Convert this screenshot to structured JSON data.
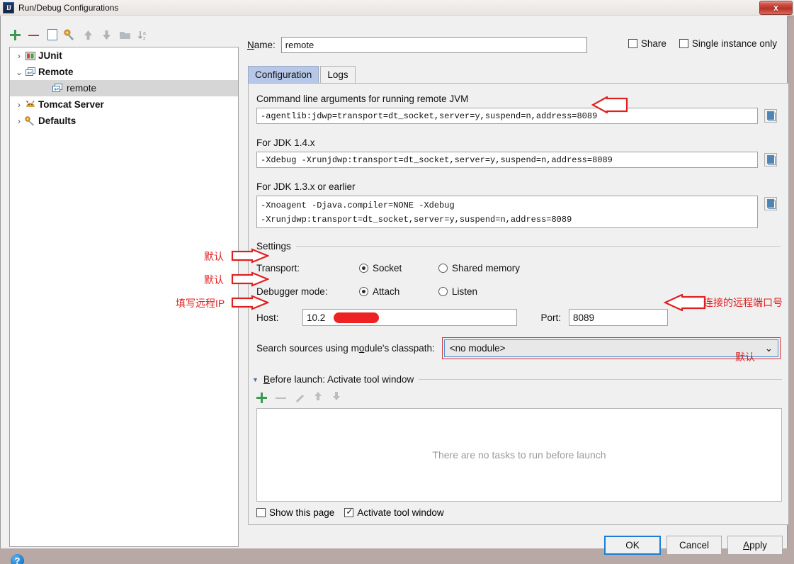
{
  "window": {
    "title": "Run/Debug Configurations",
    "app_icon": "intellij-idea-icon",
    "close_label": "x"
  },
  "left_panel": {
    "toolbar": [
      {
        "name": "add-configuration-button",
        "icon": "plus-icon"
      },
      {
        "name": "remove-configuration-button",
        "icon": "minus-icon"
      },
      {
        "name": "copy-configuration-button",
        "icon": "copy-icon"
      },
      {
        "name": "edit-templates-button",
        "icon": "wrench-icon"
      },
      {
        "name": "move-up-button",
        "icon": "arrow-up-icon"
      },
      {
        "name": "move-down-button",
        "icon": "arrow-down-icon"
      },
      {
        "name": "create-folder-button",
        "icon": "folder-icon"
      },
      {
        "name": "sort-configurations-button",
        "icon": "sort-alpha-icon"
      }
    ],
    "tree": [
      {
        "label": "JUnit",
        "icon": "junit-icon",
        "expanded": false,
        "bold": true,
        "indent": 0,
        "selected": false
      },
      {
        "label": "Remote",
        "icon": "remote-icon",
        "expanded": true,
        "bold": true,
        "indent": 0,
        "selected": false
      },
      {
        "label": "remote",
        "icon": "remote-icon",
        "expanded": null,
        "bold": false,
        "indent": 1,
        "selected": true
      },
      {
        "label": "Tomcat Server",
        "icon": "tomcat-icon",
        "expanded": false,
        "bold": true,
        "indent": 0,
        "selected": false
      },
      {
        "label": "Defaults",
        "icon": "defaults-icon",
        "expanded": false,
        "bold": true,
        "indent": 0,
        "selected": false
      }
    ]
  },
  "header": {
    "name_label": "Name:",
    "name_value": "remote",
    "name_placeholder": "",
    "share_label": "Share",
    "share_checked": false,
    "single_instance_label": "Single instance only",
    "single_instance_checked": false
  },
  "tabs": [
    {
      "label": "Configuration",
      "active": true
    },
    {
      "label": "Logs",
      "active": false
    }
  ],
  "main": {
    "cmdline_label": "Command line arguments for running remote JVM",
    "cmdline_value": "-agentlib:jdwp=transport=dt_socket,server=y,suspend=n,address=8089",
    "jdk14_label": "For JDK 1.4.x",
    "jdk14_value": "-Xdebug -Xrunjdwp:transport=dt_socket,server=y,suspend=n,address=8089",
    "jdk13_label": "For JDK 1.3.x or earlier",
    "jdk13_value_line1": "-Xnoagent -Djava.compiler=NONE -Xdebug",
    "jdk13_value_line2": "-Xrunjdwp:transport=dt_socket,server=y,suspend=n,address=8089",
    "copy_button_label": "copy-to-clipboard-icon",
    "settings_label": "Settings",
    "transport_label": "Transport:",
    "transport_options": [
      {
        "label": "Socket",
        "selected": true
      },
      {
        "label": "Shared memory",
        "selected": false
      }
    ],
    "debugger_mode_label": "Debugger mode:",
    "debugger_mode_options": [
      {
        "label": "Attach",
        "selected": true
      },
      {
        "label": "Listen",
        "selected": false
      }
    ],
    "host_label": "Host:",
    "host_value": "10.2",
    "host_redacted": true,
    "port_label": "Port:",
    "port_value": "8089",
    "module_label": "Search sources using module's classpath:",
    "module_value": "<no module>",
    "module_highlighted": true
  },
  "before_launch": {
    "title": "Before launch: Activate tool window",
    "collapse_icon": "triangle-down-icon",
    "toolbar": [
      {
        "name": "add-task-button",
        "icon": "plus-icon"
      },
      {
        "name": "remove-task-button",
        "icon": "minus-icon"
      },
      {
        "name": "edit-task-button",
        "icon": "pencil-icon"
      },
      {
        "name": "move-task-up-button",
        "icon": "arrow-up-icon"
      },
      {
        "name": "move-task-down-button",
        "icon": "arrow-down-icon"
      }
    ],
    "empty_text": "There are no tasks to run before launch",
    "show_page_label": "Show this page",
    "show_page_checked": false,
    "activate_tool_window_label": "Activate tool window",
    "activate_tool_window_checked": true
  },
  "footer": {
    "ok_label": "OK",
    "cancel_label": "Cancel",
    "apply_label": "Apply",
    "help_label": "?"
  },
  "annotations": [
    {
      "id": "transport-note",
      "text": "默认"
    },
    {
      "id": "debugger-mode-note",
      "text": "默认"
    },
    {
      "id": "host-note",
      "text": "填写远程IP"
    },
    {
      "id": "port-note",
      "text": "连接的远程端口号"
    },
    {
      "id": "module-note",
      "text": "默认"
    }
  ],
  "colors": {
    "accent": "#4a90d9",
    "annotation_red": "#e02020",
    "selection_blue": "#b6c7e8",
    "close_red": "#b93226"
  }
}
